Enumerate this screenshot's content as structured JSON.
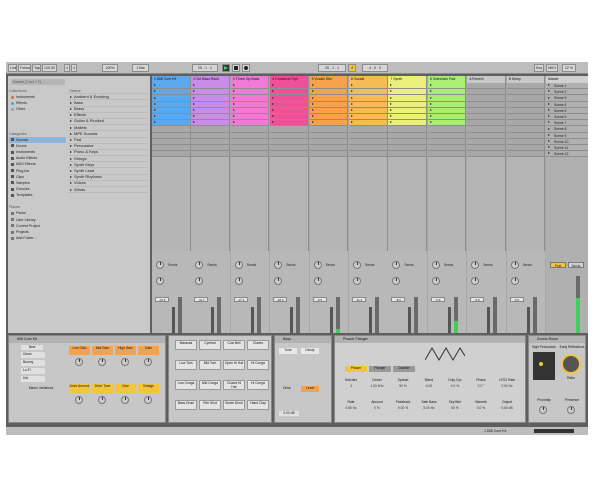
{
  "control_bar": {
    "link": "Link",
    "follow": "Follow",
    "tap": "Tap",
    "tempo": "120.00",
    "sig_num": "4",
    "sig_den": "4",
    "zoom": "100%",
    "quantize": "1 Bar",
    "position": "25 . 1 . 1",
    "loop_start": "25 . 1 . 1",
    "loop_len": "4 . 0 . 0",
    "key": "Key",
    "midi": "MIDI",
    "cpu": "22 %"
  },
  "browser": {
    "search_placeholder": "Search (Cmd + F)",
    "collections_header": "Collections",
    "categories_header": "Categories",
    "places_header": "Places",
    "collections": [
      {
        "label": "Instruments",
        "color": "#e56b2e"
      },
      {
        "label": "Effects",
        "color": "#4aa3df"
      },
      {
        "label": "Other",
        "color": "#9aa0a6"
      }
    ],
    "categories": [
      "Sounds",
      "Drums",
      "Instruments",
      "Audio Effects",
      "MIDI Effects",
      "Plug-Ins",
      "Clips",
      "Samples",
      "Grooves",
      "Templates"
    ],
    "places": [
      "Packs",
      "User Library",
      "Current Project",
      "Projects",
      "Add Folder..."
    ],
    "name_header": "Name",
    "files": [
      "Ambient & Evolving",
      "Bass",
      "Brass",
      "Effects",
      "Guitar & Plucked",
      "Mallets",
      "MPE Sounds",
      "Pad",
      "Percussive",
      "Piano & Keys",
      "Strings",
      "Synth Keys",
      "Synth Lead",
      "Synth Rhythmic",
      "Voices",
      "Winds"
    ]
  },
  "tracks": [
    {
      "name": "1 808 Core Kit",
      "color": "#5aa9f0",
      "num": "1",
      "clips": [
        1,
        1,
        1,
        1,
        1,
        1,
        1,
        0,
        0,
        0,
        0,
        0,
        0,
        0,
        0,
        0,
        0,
        0,
        0,
        0
      ]
    },
    {
      "name": "2 Sci Bass Rack",
      "color": "#c98ce8",
      "num": "2",
      "clips": [
        1,
        1,
        1,
        1,
        1,
        1,
        1,
        0,
        0,
        0,
        0,
        0,
        0,
        0,
        0,
        0,
        0,
        0,
        0,
        0
      ]
    },
    {
      "name": "3 Three Op Bass",
      "color": "#f07ad6",
      "num": "3",
      "clips": [
        1,
        1,
        1,
        1,
        1,
        1,
        1,
        0,
        0,
        0,
        0,
        0,
        0,
        0,
        0,
        0,
        0,
        0,
        0,
        0
      ]
    },
    {
      "name": "4 Crossover Syn",
      "color": "#f0509a",
      "num": "4",
      "clips": [
        1,
        1,
        1,
        1,
        1,
        1,
        1,
        0,
        0,
        0,
        0,
        0,
        0,
        0,
        0,
        0,
        0,
        0,
        0,
        0
      ]
    },
    {
      "name": "5 Vocals Stru",
      "color": "#f7a24a",
      "num": "5",
      "clips": [
        1,
        1,
        1,
        1,
        1,
        1,
        1,
        0,
        0,
        0,
        0,
        0,
        0,
        0,
        0,
        0,
        0,
        0,
        0,
        0
      ]
    },
    {
      "name": "6 Vocals",
      "color": "#f5bc55",
      "num": "6",
      "clips": [
        1,
        1,
        1,
        1,
        1,
        1,
        1,
        0,
        0,
        0,
        0,
        0,
        0,
        0,
        0,
        0,
        0,
        0,
        0,
        0
      ]
    },
    {
      "name": "7 Synth",
      "color": "#eaf07a",
      "num": "7",
      "clips": [
        1,
        1,
        1,
        1,
        1,
        1,
        1,
        0,
        0,
        0,
        0,
        0,
        0,
        0,
        0,
        0,
        0,
        0,
        0,
        0
      ]
    },
    {
      "name": "8 Sidechain Pad",
      "color": "#a9ef72",
      "num": "8",
      "clips": [
        1,
        1,
        1,
        1,
        1,
        1,
        1,
        0,
        0,
        0,
        0,
        0,
        0,
        0,
        0,
        0,
        0,
        0,
        0,
        0
      ]
    },
    {
      "name": "A Reverb",
      "color": "#c8c8c8",
      "num": "A",
      "clips": [
        0,
        0,
        0,
        0,
        0,
        0,
        0,
        0,
        0,
        0,
        0,
        0,
        0,
        0,
        0,
        0,
        0,
        0,
        0,
        0
      ]
    },
    {
      "name": "B Delay",
      "color": "#c8c8c8",
      "num": "B",
      "clips": [
        0,
        0,
        0,
        0,
        0,
        0,
        0,
        0,
        0,
        0,
        0,
        0,
        0,
        0,
        0,
        0,
        0,
        0,
        0,
        0
      ]
    }
  ],
  "volumes": [
    "-13.5",
    "-11.7",
    "-17.4",
    "-18.3",
    "-9.5",
    "-11.4",
    "-8.5",
    "-5.8",
    "-5.0",
    "-5.0"
  ],
  "meter_levels": [
    0.55,
    0.3,
    0.5,
    0.2,
    0.6,
    0.45,
    0.35,
    0.7,
    0.1,
    0.1
  ],
  "master": {
    "name": "Master",
    "scenes": [
      "Scene 1",
      "Scene 2",
      "Scene 3",
      "Scene 4",
      "Scene 5",
      "Scene 6",
      "Scene 7",
      "Scene 8",
      "Scene 9",
      "Scene 10",
      "Scene 11",
      "Scene 12"
    ],
    "post": "Post",
    "solo": "Solo",
    "sends": "Sends"
  },
  "devices": {
    "drum_rack": {
      "title": "808 Core Kit",
      "pads": [
        "Clean",
        "Boomy",
        "Lo-Fi",
        "Hot"
      ],
      "macro_label": "Macro Variations",
      "new": "New",
      "macros": [
        "Low Gain",
        "Mid Gain",
        "High Gain",
        "Gain",
        "Drive Amount",
        "Drive Tone",
        "Glue",
        "Vintage"
      ]
    },
    "drum_cells": [
      "Maracas",
      "Cymbal",
      "Cow Bell",
      "Claves",
      "Low Tom",
      "Mid Tom",
      "Open Hi Hat",
      "Hi Conga",
      "Low Conga",
      "Mid Conga",
      "Closed Hi Hat",
      "Hi Conga",
      "Bass Drum",
      "Rim Shot",
      "Snare Drum",
      "Hand Clap"
    ],
    "bass": {
      "title": "Bass",
      "tone": "Tone",
      "decay": "Decay",
      "drive": "Drive",
      "level": "Level",
      "value": "0.00 dB"
    },
    "phaser": {
      "title": "Phaser-Flanger",
      "modes": [
        "Phaser",
        "Flanger",
        "Doubler"
      ],
      "labels": [
        "Notches",
        "Center",
        "Spread",
        "Blend",
        "Duty Cyc",
        "Phase",
        "LFO2 Rate",
        "Rate",
        "Amount",
        "Feedback",
        "Safe Bass",
        "Dry/Wet",
        "Warmth",
        "Output"
      ],
      "values": [
        "4",
        "1.00 kHz",
        "50 %",
        "0.00",
        "0.0 %",
        "0.0 °",
        "0.00 Hz",
        "0.55 Hz",
        "0 %",
        "0.00 %",
        "5.00 Hz",
        "50 %",
        "0.0 %",
        "0.00 dB"
      ]
    },
    "drum_room": {
      "title": "Drums Room",
      "hpf": "High Percussion",
      "early": "Early Reflections",
      "ratio": "Ratio",
      "decay": "Decay",
      "proximity": "Proximity",
      "presence": "Presence"
    }
  },
  "status": {
    "track": "1 808 Core Kit"
  }
}
